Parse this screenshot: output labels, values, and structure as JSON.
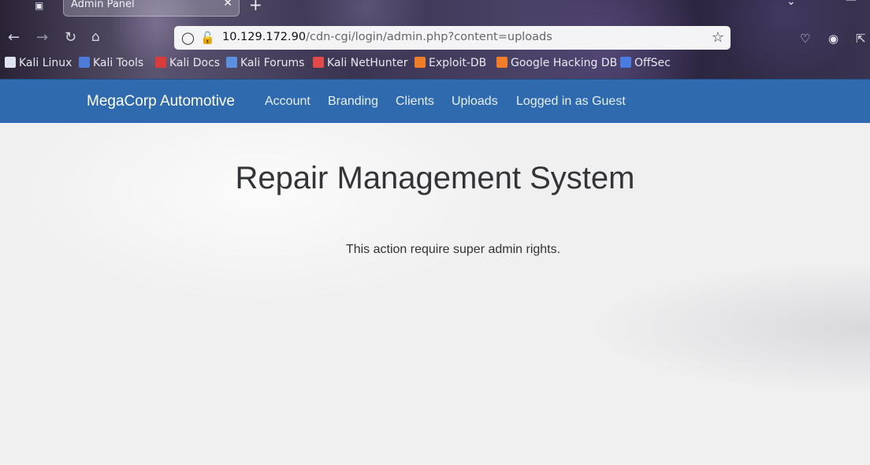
{
  "browser": {
    "tab_title": "Admin Panel",
    "url_host": "10.129.172.90",
    "url_path": "/cdn-cgi/login/admin.php?content=uploads",
    "bookmarks": [
      {
        "label": "Kali Linux",
        "color": "#dfe3ee"
      },
      {
        "label": "Kali Tools",
        "color": "#4c7bd8"
      },
      {
        "label": "Kali Docs",
        "color": "#d93b3b"
      },
      {
        "label": "Kali Forums",
        "color": "#5b8fe0"
      },
      {
        "label": "Kali NetHunter",
        "color": "#e24a4a"
      },
      {
        "label": "Exploit-DB",
        "color": "#f07d2a"
      },
      {
        "label": "Google Hacking DB",
        "color": "#f07d2a"
      },
      {
        "label": "OffSec",
        "color": "#4a7be0"
      }
    ]
  },
  "site": {
    "brand": "MegaCorp Automotive",
    "nav": [
      {
        "label": "Account"
      },
      {
        "label": "Branding"
      },
      {
        "label": "Clients"
      },
      {
        "label": "Uploads"
      },
      {
        "label": "Logged in as Guest"
      }
    ],
    "title": "Repair Management System",
    "message": "This action require super admin rights.",
    "colors": {
      "navbar": "#2e6aad"
    }
  }
}
